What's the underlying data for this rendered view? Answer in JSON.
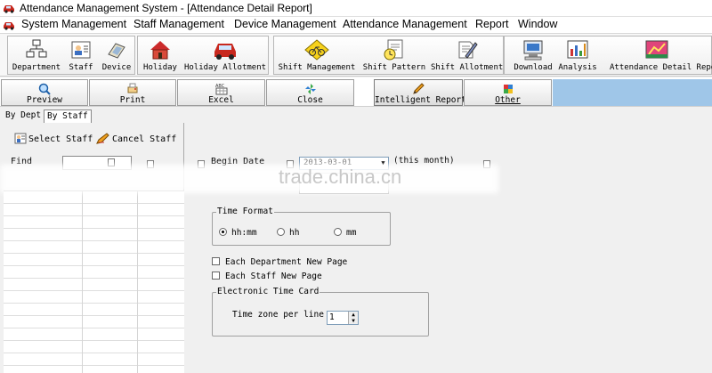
{
  "window": {
    "title": "Attendance Management System - [Attendance Detail Report]"
  },
  "menu": [
    "System Management",
    "Staff Management",
    "Device Management",
    "Attendance Management",
    "Report",
    "Window"
  ],
  "toolbar": {
    "department": "Department",
    "staff": "Staff",
    "device": "Device",
    "holiday": "Holiday",
    "holiday_allotment": "Holiday Allotment",
    "shift_management": "Shift Management",
    "shift_pattern": "Shift Pattern",
    "shift_allotment": "Shift Allotment",
    "download": "Download",
    "analysis": "Analysis",
    "attendance_detail_report": "Attendance Detail Report"
  },
  "report_toolbar": {
    "preview": "Preview",
    "print": "Print",
    "excel": "Excel",
    "excel_icon_text": "ABC",
    "close": "Close",
    "intelligent_report": "Intelligent Report",
    "other": "Other"
  },
  "tabs": {
    "by_dept": "By Dept",
    "by_staff": "By Staff"
  },
  "left": {
    "select_staff": "Select Staff",
    "cancel_staff": "Cancel Staff",
    "find_label": "Find",
    "find_value": ""
  },
  "options": {
    "begin_date_label": "Begin Date",
    "begin_date_value": "2013-03-01",
    "this_month": "(this month)",
    "time_format_legend": "Time Format",
    "time_format_options": [
      "hh:mm",
      "hh",
      "mm"
    ],
    "time_format_selected": "hh:mm",
    "each_department_new_page": "Each Department New Page",
    "each_staff_new_page": "Each Staff New Page",
    "electronic_time_card_legend": "Electronic Time Card",
    "time_zone_per_line_label": "Time zone per line",
    "time_zone_per_line_value": "1"
  },
  "watermark": "trade.china.cn",
  "colors": {
    "accent_blue": "#9fc6e8",
    "window_bg": "#f0f0f0"
  }
}
